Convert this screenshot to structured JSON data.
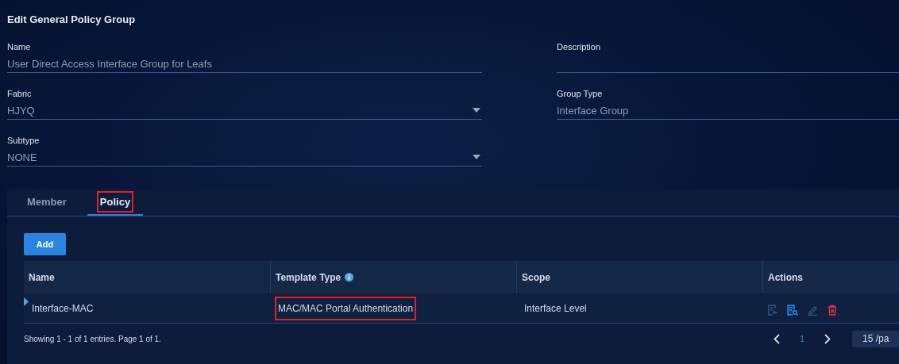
{
  "title": "Edit General Policy Group",
  "fields": [
    {
      "label": "Name",
      "value": "User Direct Access Interface Group for Leafs",
      "kind": "text"
    },
    {
      "label": "Description",
      "kind": "text"
    },
    {
      "label": "Fabric",
      "value": "HJYQ",
      "kind": "select"
    },
    {
      "label": "Group Type",
      "value": "Interface Group",
      "kind": "text"
    },
    {
      "label": "Subtype",
      "value": "NONE",
      "kind": "select"
    }
  ],
  "tabs": [
    {
      "label": "Member",
      "selected": false,
      "highlighted": false
    },
    {
      "label": "Policy",
      "selected": true,
      "highlighted": true
    }
  ],
  "add_button": "Add",
  "table": {
    "columns": [
      {
        "label": "Name"
      },
      {
        "label": "Template Type",
        "info": true
      },
      {
        "label": "Scope"
      },
      {
        "label": "Actions"
      }
    ],
    "rows": [
      {
        "cells": [
          {
            "text": "Interface-MAC",
            "highlighted": false
          },
          {
            "text": "MAC/MAC Portal Authentication",
            "highlighted": true
          },
          {
            "text": "Interface Level",
            "highlighted": false
          }
        ],
        "expanded": false,
        "actions": [
          {
            "kind": "import",
            "disabled": true
          },
          {
            "kind": "view",
            "disabled": false
          },
          {
            "kind": "edit",
            "disabled": true
          },
          {
            "kind": "delete",
            "disabled": false
          }
        ]
      }
    ]
  },
  "footer": {
    "summary": "Showing 1 - 1 of 1 entries. Page 1 of 1.",
    "pages": [
      {
        "label": "1",
        "selected": true
      }
    ],
    "page_size": "15 /pa"
  }
}
